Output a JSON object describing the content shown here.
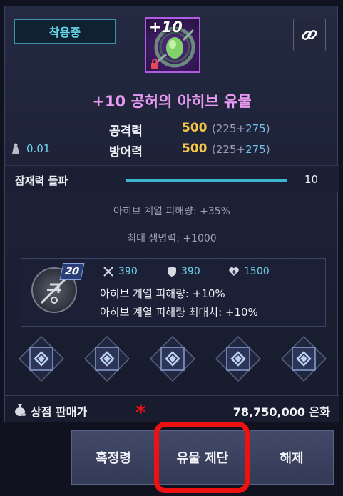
{
  "equip_status": "착용중",
  "item": {
    "enhance": "+10",
    "name": "+10 공허의 아히브 유물"
  },
  "stats": {
    "attack_label": "공격력",
    "attack_value": "500",
    "attack_base": "(225+",
    "attack_bonus": "275",
    "defense_label": "방어력",
    "defense_value": "500",
    "defense_base": "(225+",
    "defense_bonus": "275",
    "close_paren": ")",
    "weight": "0.01"
  },
  "potential": {
    "label": "잠재력 돌파",
    "value": "10",
    "fill_fraction": 1.0
  },
  "options": [
    "아히브 계열 피해량: +35%",
    "최대 생명력: +1000"
  ],
  "skill": {
    "level": "20",
    "attack": "390",
    "defense": "390",
    "hp": "1500",
    "lines": [
      "아히브 계열 피해량: +10%",
      "아히브 계열 피해량 최대치: +10%"
    ]
  },
  "slots": [
    {
      "icon": "rune-slot-icon"
    },
    {
      "icon": "rune-slot-icon"
    },
    {
      "icon": "rune-slot-icon"
    },
    {
      "icon": "rune-slot-icon"
    },
    {
      "icon": "rune-slot-icon"
    }
  ],
  "price": {
    "label": "상점 판매가",
    "value": "78,750,000 은화"
  },
  "buttons": {
    "left": "흑정령",
    "middle": "유물 제단",
    "right": "해제"
  },
  "annotation": {
    "mark": "*",
    "color": "#ee1111"
  },
  "colors": {
    "accent_cyan": "#3bb6ce",
    "item_name": "#e79af0",
    "stat_gold": "#f5c545"
  }
}
